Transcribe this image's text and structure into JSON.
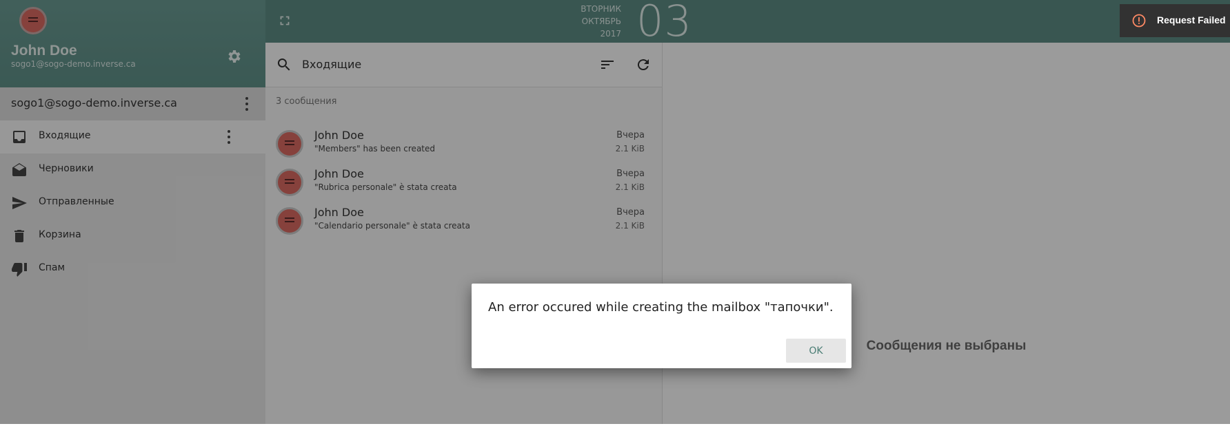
{
  "sidebar": {
    "user_name": "John Doe",
    "user_email": "sogo1@sogo-demo.inverse.ca",
    "account": "sogo1@sogo-demo.inverse.ca",
    "folders": [
      {
        "label": "Входящие",
        "icon": "inbox-icon"
      },
      {
        "label": "Черновики",
        "icon": "drafts-icon"
      },
      {
        "label": "Отправленные",
        "icon": "send-icon"
      },
      {
        "label": "Корзина",
        "icon": "trash-icon"
      },
      {
        "label": "Спам",
        "icon": "thumb-down-icon"
      }
    ]
  },
  "topbar": {
    "weekday": "ВТОРНИК",
    "month": "ОКТЯБРЬ",
    "year": "2017",
    "day": "03"
  },
  "messages": {
    "search_label": "Входящие",
    "count": "3 сообщения",
    "items": [
      {
        "from": "John Doe",
        "subject": "\"Members\" has been created",
        "date": "Вчера",
        "size": "2.1 KiB"
      },
      {
        "from": "John Doe",
        "subject": "\"Rubrica personale\" è stata creata",
        "date": "Вчера",
        "size": "2.1 KiB"
      },
      {
        "from": "John Doe",
        "subject": "\"Calendario personale\" è stata creata",
        "date": "Вчера",
        "size": "2.1 KiB"
      }
    ]
  },
  "viewer": {
    "empty_text": "Сообщения не выбраны"
  },
  "toast": {
    "text": "Request Failed"
  },
  "dialog": {
    "message": "An error occured while creating the mailbox \"тапочки\".",
    "ok_label": "OK"
  },
  "colors": {
    "header_teal": "#5c8b83",
    "accent_text": "#4a7d74",
    "toast_bg": "#323232",
    "toast_icon": "#ff8a65"
  }
}
